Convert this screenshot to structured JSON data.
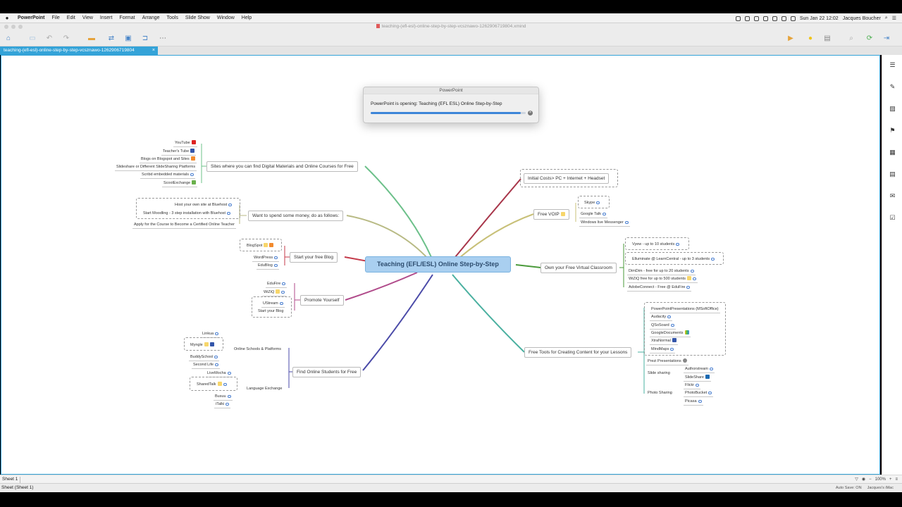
{
  "menubar": {
    "app_name": "PowerPoint",
    "items": [
      "File",
      "Edit",
      "View",
      "Insert",
      "Format",
      "Arrange",
      "Tools",
      "Slide Show",
      "Window",
      "Help"
    ],
    "datetime": "Sun Jan 22  12:02",
    "user": "Jacques Boucher"
  },
  "window": {
    "title": "teaching-(efl-esl)-online-step-by-step-vcsznawo-1262906719804.xmind"
  },
  "tab": {
    "label": "teaching-(efl-esl)-online-step-by-step-vcsznawo-1262906719804",
    "close": "×"
  },
  "mindmap": {
    "central": "Teaching (EFL/ESL) Online Step-by-Step",
    "topics": {
      "sites": "Sites where you can find Digital Materials and Online Courses for Free",
      "spend": "Want to spend some money, do as follows:",
      "blog": "Start your free Blog",
      "promote": "Promote Yourself",
      "students": "Find Online Students for Free",
      "costs": "Initial Costs> PC + Internet + Headset",
      "voip": "Free VOIP",
      "classroom": "Own your Free Virtual Classroom",
      "tools": "Free Tools for Creating Content for your Lessons"
    },
    "sites_items": [
      "YouTube",
      "Teacher's Tube",
      "Blogs on Blogspot and Sites",
      "Slideshare or Different SlideSharing Platforms",
      "Scribd embedded materials",
      "ScoolExchange"
    ],
    "spend_items": [
      "Host your own site at Bluehost",
      "Start Moodling - 3 step installation with Bluehost",
      "Apply for the Course to Become a Certified  Online Teacher"
    ],
    "blog_items": [
      "BlogSpot",
      "WordPress",
      "EduBlog"
    ],
    "promote_items": [
      "EduFire",
      "WiZiQ",
      "UStream",
      "Start your Blog"
    ],
    "students_groups": {
      "schools": "Online Schools & Platforms",
      "exchange": "Language Exchange"
    },
    "schools_items": [
      "Linkua",
      "Myngle",
      "BuddySchool",
      "Second Life"
    ],
    "exchange_items": [
      "LiveMocha",
      "SharedTalk",
      "Busuu",
      "iTalki"
    ],
    "voip_items": [
      "Skype",
      "Google Talk",
      "Windows live Messenger"
    ],
    "classroom_items": [
      "Vyew - up to 10 students",
      "Elluminate @ LearnCentral - up to 3 students",
      "DimDim - free for up to 20 students",
      "WiZiQ free for up to 500 students",
      "AdobeConnect - Free @ EduFire"
    ],
    "tools_items": [
      "PowerPointPresentations (MSoftOffice)",
      "Audacity",
      "QSoSoard",
      "GoogleDocuments",
      "XtraNormal",
      "MindMaps",
      "Prezi Presentations"
    ],
    "slide_sharing": {
      "label": "Slide sharing",
      "items": [
        "Authorstream",
        "SlideShare"
      ]
    },
    "photo_sharing": {
      "label": "Photo Sharing",
      "items": [
        "Flickr",
        "PhotoBucket",
        "Picasa"
      ]
    }
  },
  "dialog": {
    "title": "PowerPoint",
    "message": "PowerPoint is opening: Teaching (EFL ESL) Online Step-by-Step",
    "progress": 0.97
  },
  "sheetbar": {
    "tab": "Sheet 1",
    "zoom": "100%"
  },
  "statusbar": {
    "left": "Sheet (Sheet 1)",
    "autosave": "Auto Save: ON",
    "machine": "Jacques's iMac"
  },
  "colors": {
    "accent": "#34a3d8",
    "central": "#a9cff0"
  }
}
